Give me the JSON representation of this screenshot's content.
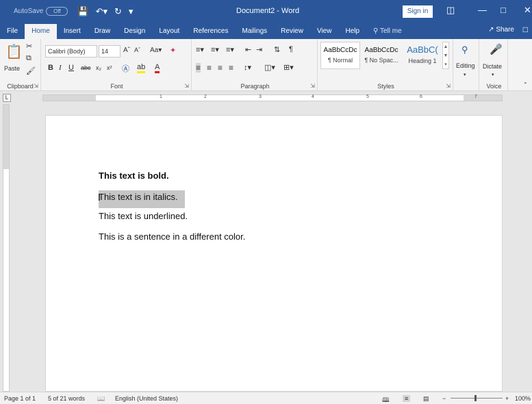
{
  "titlebar": {
    "autosave_label": "AutoSave",
    "autosave_state": "Off",
    "doc_title": "Document2  -  Word",
    "signin": "Sign in"
  },
  "tabs": {
    "items": [
      "File",
      "Home",
      "Insert",
      "Draw",
      "Design",
      "Layout",
      "References",
      "Mailings",
      "Review",
      "View",
      "Help"
    ],
    "tell_me": "Tell me",
    "share": "Share"
  },
  "ribbon": {
    "clipboard": {
      "paste": "Paste",
      "label": "Clipboard"
    },
    "font": {
      "name": "Calibri (Body)",
      "size": "14",
      "label": "Font"
    },
    "paragraph": {
      "label": "Paragraph"
    },
    "styles": {
      "label": "Styles",
      "items": [
        {
          "sample": "AaBbCcDc",
          "name": "¶ Normal"
        },
        {
          "sample": "AaBbCcDc",
          "name": "¶ No Spac..."
        },
        {
          "sample": "AaBbC(",
          "name": "Heading 1"
        }
      ]
    },
    "editing": {
      "label": "Editing"
    },
    "voice": {
      "dictate": "Dictate",
      "label": "Voice"
    }
  },
  "document": {
    "lines": [
      "This text is bold.",
      "This text is in italics.",
      "This text is underlined.",
      "This is a sentence in a different color."
    ]
  },
  "status": {
    "page": "Page 1 of 1",
    "words": "5 of 21 words",
    "language": "English (United States)",
    "zoom": "100%"
  },
  "ruler": {
    "numbers": [
      "1",
      "2",
      "3",
      "4",
      "5",
      "6",
      "7"
    ]
  }
}
